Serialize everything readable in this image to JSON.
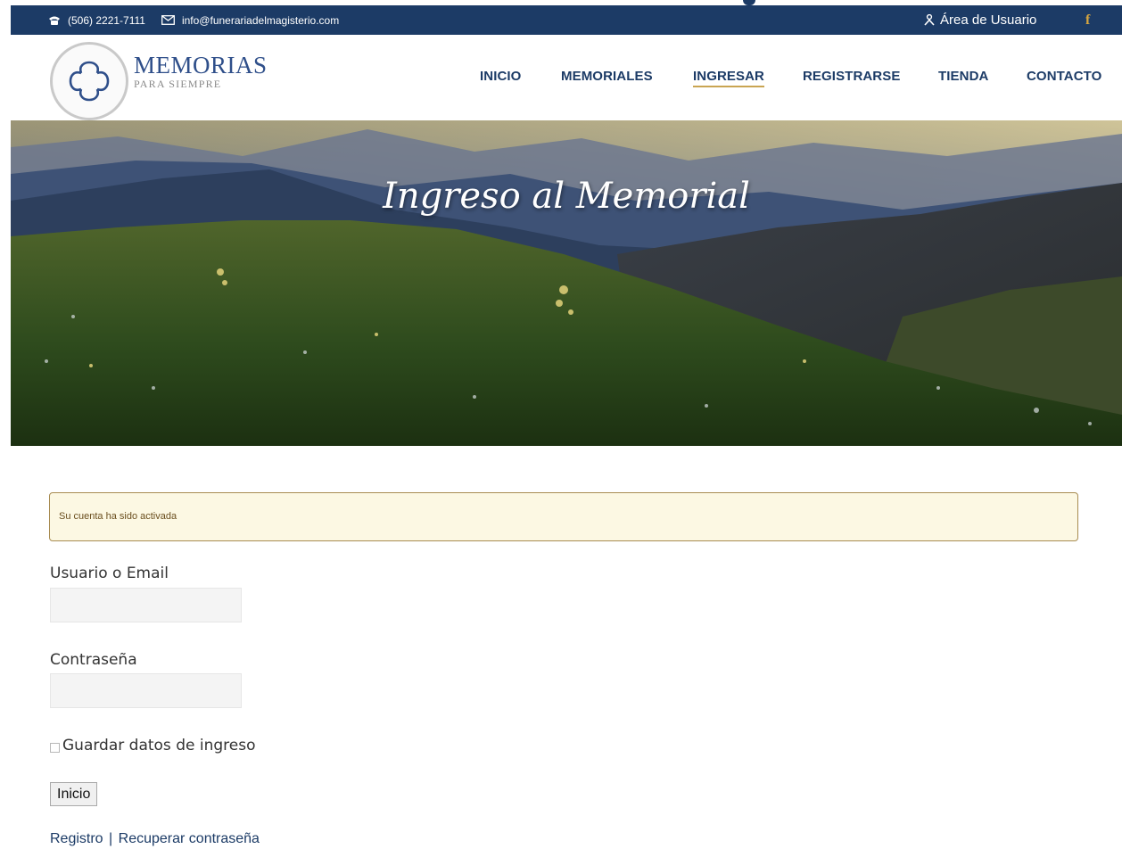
{
  "topbar": {
    "phone": "(506) 2221-7111",
    "email": "info@funerariadelmagisterio.com",
    "user_area": "Área de Usuario",
    "facebook": "f"
  },
  "brand": {
    "title_main": "MEMORIAS",
    "subtitle": "PARA SIEMPRE"
  },
  "nav": {
    "items": [
      {
        "label": "INICIO"
      },
      {
        "label": "MEMORIALES"
      },
      {
        "label": "INGRESAR",
        "active": true
      },
      {
        "label": "REGISTRARSE"
      },
      {
        "label": "TIENDA"
      },
      {
        "label": "CONTACTO"
      }
    ]
  },
  "hero": {
    "title": "Ingreso al Memorial"
  },
  "alert": {
    "message": "Su cuenta ha sido activada"
  },
  "form": {
    "username_label": "Usuario o Email",
    "username_value": "",
    "password_label": "Contraseña",
    "password_value": "",
    "remember_label": "Guardar datos de ingreso",
    "remember_checked": false,
    "submit_label": "Inicio"
  },
  "links": {
    "register": "Registro",
    "separator": "|",
    "recover": "Recuperar contraseña"
  },
  "colors": {
    "topbar_bg": "#1c3b66",
    "nav_text": "#1c3b66",
    "accent_gold": "#c9a552",
    "alert_bg": "#fcf8e3",
    "alert_border": "#a88c52"
  },
  "icons": [
    "phone-icon",
    "envelope-icon",
    "user-icon",
    "facebook-icon",
    "clover-logo-icon"
  ]
}
